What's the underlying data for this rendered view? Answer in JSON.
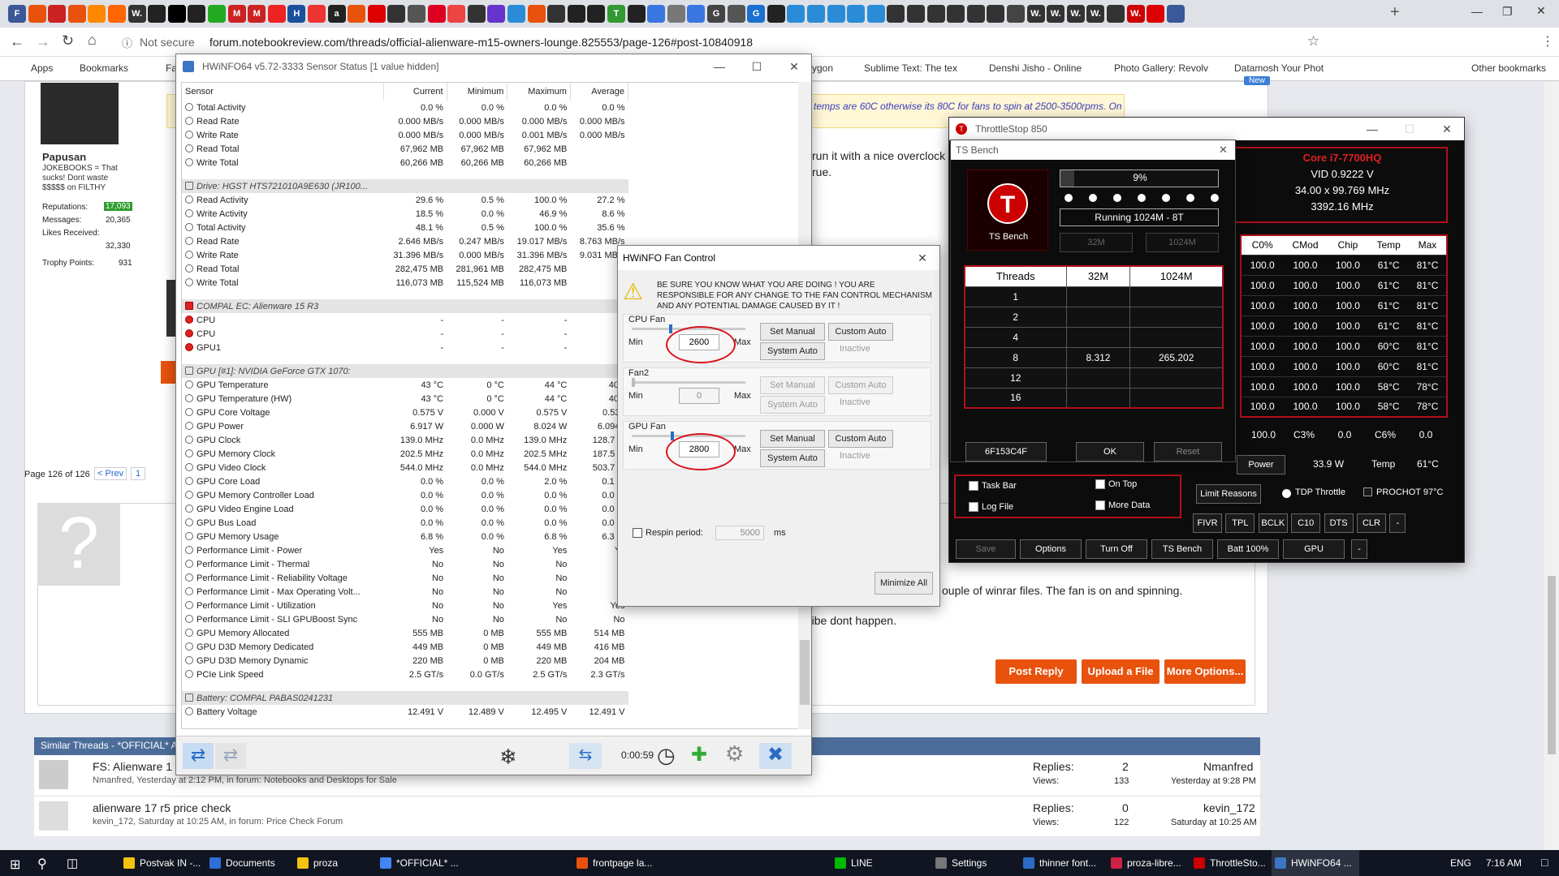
{
  "browser": {
    "url": "forum.notebookreview.com/threads/official-alienware-m15-owners-lounge.825553/page-126#post-10840918",
    "security": "Not secure",
    "bookmarks": [
      "Apps",
      "Bookmarks",
      "Fac",
      "ygon",
      "Sublime Text: The tex",
      "Denshi Jisho - Online",
      "Photo Gallery: Revolv",
      "Datamosh Your Phot",
      "Other bookmarks"
    ],
    "tab_icons": [
      "F",
      "",
      "",
      "",
      "",
      "",
      "W.",
      "",
      "",
      "",
      "",
      "M",
      "M",
      "",
      "H",
      "",
      "a",
      "",
      "",
      "",
      "",
      "",
      "",
      "",
      "",
      "",
      "",
      "",
      "",
      "",
      "T",
      "",
      "",
      "",
      "",
      "G",
      "",
      "G",
      "",
      "",
      "",
      "",
      "",
      "",
      "",
      "",
      "",
      "",
      "",
      "",
      "",
      "W.",
      "W.",
      "W.",
      "W.",
      "",
      "W.",
      "",
      ""
    ]
  },
  "forum": {
    "user": {
      "name": "Papusan",
      "title": "JOKEBOOKS = That sucks! Dont waste $$$$$ on FILTHY",
      "rep_label": "Reputations:",
      "rep": "17,093",
      "msg_label": "Messages:",
      "msgs": "20,365",
      "likes_label": "Likes Received:",
      "likes": "32,330",
      "trophy_label": "Trophy Points:",
      "trophy": "931"
    },
    "quote": "temps are 60C otherwise its 80C for fans to spin at 2500-3500rpms. On",
    "post_text1": "run it with a nice overclock",
    "post_text2": "rue.",
    "pagination": {
      "label": "Page 126 of 126",
      "prev": "< Prev",
      "page": "1"
    },
    "post2_text1": "ouple of winrar files. The fan is on and spinning.",
    "post2_text2": "ribe dont happen.",
    "buttons": {
      "reply": "Post Reply",
      "upload": "Upload a File",
      "more": "More Options..."
    },
    "similar_header": "Similar Threads - *OFFICIAL* A",
    "threads": [
      {
        "title": "FS: Alienware 1",
        "meta": "Nmanfred, Yesterday at 2:12 PM, in forum: Notebooks and Desktops for Sale",
        "replies_label": "Replies:",
        "replies": "2",
        "views_label": "Views:",
        "views": "133",
        "last_user": "Nmanfred",
        "last_time": "Yesterday at 9:28 PM"
      },
      {
        "title": "alienware 17 r5 price check",
        "meta": "kevin_172, Saturday at 10:25 AM, in forum: Price Check Forum",
        "replies_label": "Replies:",
        "replies": "0",
        "views_label": "Views:",
        "views": "122",
        "last_user": "kevin_172",
        "last_time": "Saturday at 10:25 AM"
      }
    ],
    "new_badge": "New"
  },
  "hwinfo": {
    "title": "HWiNFO64 v5.72-3333 Sensor Status [1 value hidden]",
    "headers": [
      "Sensor",
      "Current",
      "Minimum",
      "Maximum",
      "Average"
    ],
    "rows": [
      [
        "Total Activity",
        "0.0 %",
        "0.0 %",
        "0.0 %",
        "0.0 %",
        ""
      ],
      [
        "Read Rate",
        "0.000 MB/s",
        "0.000 MB/s",
        "0.000 MB/s",
        "0.000 MB/s",
        ""
      ],
      [
        "Write Rate",
        "0.000 MB/s",
        "0.000 MB/s",
        "0.001 MB/s",
        "0.000 MB/s",
        ""
      ],
      [
        "Read Total",
        "67,962 MB",
        "67,962 MB",
        "67,962 MB",
        "",
        ""
      ],
      [
        "Write Total",
        "60,266 MB",
        "60,266 MB",
        "60,266 MB",
        "",
        ""
      ],
      [
        "",
        "",
        "",
        "",
        "",
        "gap"
      ],
      [
        "Drive: HGST HTS721010A9E630 (JR100...",
        "",
        "",
        "",
        "",
        "sec"
      ],
      [
        "Read Activity",
        "29.6 %",
        "0.5 %",
        "100.0 %",
        "27.2 %",
        ""
      ],
      [
        "Write Activity",
        "18.5 %",
        "0.0 %",
        "46.9 %",
        "8.6 %",
        ""
      ],
      [
        "Total Activity",
        "48.1 %",
        "0.5 %",
        "100.0 %",
        "35.6 %",
        ""
      ],
      [
        "Read Rate",
        "2.646 MB/s",
        "0.247 MB/s",
        "19.017 MB/s",
        "8.763 MB/s",
        ""
      ],
      [
        "Write Rate",
        "31.396 MB/s",
        "0.000 MB/s",
        "31.396 MB/s",
        "9.031 MB/s",
        ""
      ],
      [
        "Read Total",
        "282,475 MB",
        "281,961 MB",
        "282,475 MB",
        "",
        ""
      ],
      [
        "Write Total",
        "116,073 MB",
        "115,524 MB",
        "116,073 MB",
        "",
        ""
      ],
      [
        "",
        "",
        "",
        "",
        "",
        "gap"
      ],
      [
        "COMPAL EC: Alienware 15 R3",
        "",
        "",
        "",
        "",
        "secx"
      ],
      [
        "CPU",
        "-",
        "-",
        "-",
        "",
        "x"
      ],
      [
        "CPU",
        "-",
        "-",
        "-",
        "",
        "x"
      ],
      [
        "GPU1",
        "-",
        "-",
        "-",
        "",
        "x"
      ],
      [
        "",
        "",
        "",
        "",
        "",
        "gap"
      ],
      [
        "GPU [#1]: NVIDIA GeForce GTX 1070:",
        "",
        "",
        "",
        "",
        "sec"
      ],
      [
        "GPU Temperature",
        "43 °C",
        "0 °C",
        "44 °C",
        "40 °",
        ""
      ],
      [
        "GPU Temperature (HW)",
        "43 °C",
        "0 °C",
        "44 °C",
        "40 °",
        ""
      ],
      [
        "GPU Core Voltage",
        "0.575 V",
        "0.000 V",
        "0.575 V",
        "0.532",
        ""
      ],
      [
        "GPU Power",
        "6.917 W",
        "0.000 W",
        "8.024 W",
        "6.094 \\",
        ""
      ],
      [
        "GPU Clock",
        "139.0 MHz",
        "0.0 MHz",
        "139.0 MHz",
        "128.7 M",
        ""
      ],
      [
        "GPU Memory Clock",
        "202.5 MHz",
        "0.0 MHz",
        "202.5 MHz",
        "187.5 M",
        ""
      ],
      [
        "GPU Video Clock",
        "544.0 MHz",
        "0.0 MHz",
        "544.0 MHz",
        "503.7 M",
        ""
      ],
      [
        "GPU Core Load",
        "0.0 %",
        "0.0 %",
        "2.0 %",
        "0.1 %",
        ""
      ],
      [
        "GPU Memory Controller Load",
        "0.0 %",
        "0.0 %",
        "0.0 %",
        "0.0 %",
        ""
      ],
      [
        "GPU Video Engine Load",
        "0.0 %",
        "0.0 %",
        "0.0 %",
        "0.0 %",
        ""
      ],
      [
        "GPU Bus Load",
        "0.0 %",
        "0.0 %",
        "0.0 %",
        "0.0 %",
        ""
      ],
      [
        "GPU Memory Usage",
        "6.8 %",
        "0.0 %",
        "6.8 %",
        "6.3 %",
        ""
      ],
      [
        "Performance Limit - Power",
        "Yes",
        "No",
        "Yes",
        "Ye",
        ""
      ],
      [
        "Performance Limit - Thermal",
        "No",
        "No",
        "No",
        "N",
        ""
      ],
      [
        "Performance Limit - Reliability Voltage",
        "No",
        "No",
        "No",
        "N",
        ""
      ],
      [
        "Performance Limit - Max Operating Volt...",
        "No",
        "No",
        "No",
        "N",
        ""
      ],
      [
        "Performance Limit - Utilization",
        "No",
        "No",
        "Yes",
        "Yes",
        ""
      ],
      [
        "Performance Limit - SLI GPUBoost Sync",
        "No",
        "No",
        "No",
        "No",
        ""
      ],
      [
        "GPU Memory Allocated",
        "555 MB",
        "0 MB",
        "555 MB",
        "514 MB",
        ""
      ],
      [
        "GPU D3D Memory Dedicated",
        "449 MB",
        "0 MB",
        "449 MB",
        "416 MB",
        ""
      ],
      [
        "GPU D3D Memory Dynamic",
        "220 MB",
        "0 MB",
        "220 MB",
        "204 MB",
        ""
      ],
      [
        "PCIe Link Speed",
        "2.5 GT/s",
        "0.0 GT/s",
        "2.5 GT/s",
        "2.3 GT/s",
        ""
      ],
      [
        "",
        "",
        "",
        "",
        "",
        "gap"
      ],
      [
        "Battery: COMPAL PABAS0241231",
        "",
        "",
        "",
        "",
        "sec"
      ],
      [
        "Battery Voltage",
        "12.491 V",
        "12.489 V",
        "12.495 V",
        "12.491 V",
        ""
      ]
    ],
    "timer": "0:00:59"
  },
  "fan": {
    "title": "HWiNFO Fan Control",
    "warning": "BE SURE YOU KNOW WHAT YOU ARE DOING ! YOU ARE RESPONSIBLE FOR ANY CHANGE TO THE FAN CONTROL MECHANISM AND ANY POTENTIAL DAMAGE CAUSED BY IT !",
    "groups": [
      {
        "name": "CPU Fan",
        "value": "2600",
        "status": "Inactive"
      },
      {
        "name": "Fan2",
        "value": "0",
        "status": "Inactive"
      },
      {
        "name": "GPU Fan",
        "value": "2800",
        "status": "Inactive"
      }
    ],
    "min": "Min",
    "max": "Max",
    "set_manual": "Set Manual",
    "custom_auto": "Custom Auto",
    "system_auto": "System Auto",
    "respin": "Respin period:",
    "respin_value": "5000",
    "respin_unit": "ms",
    "minimize": "Minimize All"
  },
  "throttlestop": {
    "title": "ThrottleStop 850",
    "cpu": "Core i7-7700HQ",
    "vid": "VID  0.9222 V",
    "mult": "34.00 x 99.769 MHz",
    "freq": "3392.16 MHz",
    "headers": [
      "C0%",
      "CMod",
      "Chip",
      "Temp",
      "Max"
    ],
    "rows": [
      [
        "100.0",
        "100.0",
        "100.0",
        "61°C",
        "81°C"
      ],
      [
        "100.0",
        "100.0",
        "100.0",
        "61°C",
        "81°C"
      ],
      [
        "100.0",
        "100.0",
        "100.0",
        "61°C",
        "81°C"
      ],
      [
        "100.0",
        "100.0",
        "100.0",
        "61°C",
        "81°C"
      ],
      [
        "100.0",
        "100.0",
        "100.0",
        "60°C",
        "81°C"
      ],
      [
        "100.0",
        "100.0",
        "100.0",
        "60°C",
        "81°C"
      ],
      [
        "100.0",
        "100.0",
        "100.0",
        "58°C",
        "78°C"
      ],
      [
        "100.0",
        "100.0",
        "100.0",
        "58°C",
        "78°C"
      ]
    ],
    "summary": [
      "100.0",
      "C3%",
      "0.0",
      "C6%",
      "0.0"
    ],
    "power_label": "Power",
    "power": "33.9 W",
    "temp_label": "Temp",
    "temp": "61°C",
    "checks": [
      "Task Bar",
      "On Top",
      "Log File",
      "More Data"
    ],
    "limit_reasons": "Limit Reasons",
    "tdp": "TDP Throttle",
    "prochot": "PROCHOT 97°C",
    "row_buttons": [
      "FIVR",
      "TPL",
      "BCLK",
      "C10",
      "DTS",
      "CLR",
      "-"
    ],
    "bottom_buttons": [
      "Save",
      "Options",
      "Turn Off",
      "TS Bench",
      "Batt 100%",
      "GPU",
      "-"
    ]
  },
  "tsbench": {
    "title": "TS Bench",
    "logo": "T",
    "logo_label": "TS Bench",
    "progress": "9%",
    "progress_value": 9,
    "running": "Running 1024M - 8T",
    "size1": "32M",
    "size2": "1024M",
    "col_headers": [
      "Threads",
      "32M",
      "1024M"
    ],
    "rows": [
      [
        "1",
        "",
        ""
      ],
      [
        "2",
        "",
        ""
      ],
      [
        "4",
        "",
        ""
      ],
      [
        "8",
        "8.312",
        "265.202"
      ],
      [
        "12",
        "",
        ""
      ],
      [
        "16",
        "",
        ""
      ]
    ],
    "hash": "6F153C4F",
    "ok": "OK",
    "reset": "Reset"
  },
  "taskbar": {
    "items": [
      "Postvak IN -...",
      "Documents",
      "proza",
      "*OFFICIAL* ...",
      "frontpage la...",
      "LINE",
      "Settings",
      "thinner font...",
      "proza-libre...",
      "ThrottleSto...",
      "HWiNFO64 ..."
    ],
    "lang": "ENG",
    "time": "7:16 AM"
  }
}
